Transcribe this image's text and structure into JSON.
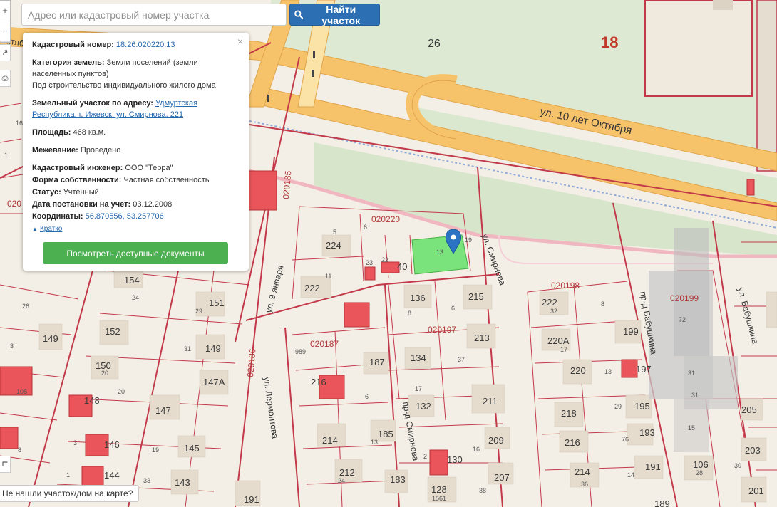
{
  "search": {
    "placeholder": "Адрес или кадастровый номер участка",
    "button_label": "Найти участок",
    "icon": "search-icon"
  },
  "zoom": {
    "plus": "+",
    "minus": "−"
  },
  "popup": {
    "cadastral_label": "Кадастровый номер:",
    "cadastral_value": "18:26:020220:13",
    "category_label": "Категория земель:",
    "category_value": "Земли поселений (земли населенных пунктов)",
    "category_use": "Под строительство индивидуального жилого дома",
    "address_label": "Земельный участок по адресу:",
    "address_value": "Удмуртская Республика, г. Ижевск, ул. Смирнова, 221",
    "area_label": "Площадь:",
    "area_value": "468 кв.м.",
    "survey_label": "Межевание:",
    "survey_value": "Проведено",
    "engineer_label": "Кадастровый инженер:",
    "engineer_value": "ООО \"Терра\"",
    "ownership_label": "Форма собственности:",
    "ownership_value": "Частная собственность",
    "status_label": "Статус:",
    "status_value": "Учтенный",
    "reg_date_label": "Дата постановки на учет:",
    "reg_date_value": "03.12.2008",
    "coords_label": "Координаты:",
    "coords_value": "56.870556, 53.257706",
    "collapse_label": "Кратко",
    "docs_button": "Посмотреть доступные документы",
    "close": "×"
  },
  "not_found_label": "Не нашли участок/дом на карте?",
  "map": {
    "street_labels": {
      "oktyabrya": "ул. 10 лет Октября",
      "smirnova": "ул. Смирнова",
      "smirnova_lane": "пр-д Смирнова",
      "yanvarya": "ул. 9 января",
      "babushkina": "ул. Бабушкина",
      "babushkina_lane": "пр-д Бабушкина",
      "lemontova": "ул. Лермонтова",
      "partial_left": "Октяб"
    },
    "quarters": {
      "q020220": "020220",
      "q020197": "020197",
      "q020198": "020198",
      "q020199": "020199",
      "q020187": "020187",
      "q020185": "020185",
      "q020186": "020186",
      "q020_left": "020"
    },
    "big_numbers": {
      "n18": "18",
      "n26": "26"
    },
    "house_numbers": {
      "h224": "224",
      "h222": "222",
      "h5": "5",
      "h6": "6",
      "h11": "11",
      "h22": "22",
      "h40": "40",
      "h13": "13",
      "h19": "19",
      "h23": "23",
      "h136": "136",
      "h215": "215",
      "h213": "213",
      "h8": "8",
      "h6b": "6",
      "h37": "37",
      "h134": "134",
      "h17": "17",
      "h132": "132",
      "h211": "211",
      "h209": "209",
      "h16": "16",
      "h207": "207",
      "h128": "128",
      "h130": "130",
      "h2": "2",
      "h38": "38",
      "h1561": "1561",
      "h187": "187",
      "h216": "216",
      "h6c": "6",
      "h185": "185",
      "h214": "214",
      "h212": "212",
      "h183": "183",
      "h24": "24",
      "h13b": "13",
      "h989": "989",
      "h222b": "222",
      "h8b": "8",
      "h32": "32",
      "h199": "199",
      "h220A": "220А",
      "h17b": "17",
      "h220": "220",
      "h13c": "13",
      "h197": "197",
      "h218": "218",
      "h29": "29",
      "h195": "195",
      "h216b": "216",
      "h76": "76",
      "h193": "193",
      "h214b": "214",
      "h36": "36",
      "h191": "191",
      "h14": "14",
      "h72": "72",
      "h31": "31",
      "h31b": "31",
      "h15": "15",
      "h106": "106",
      "h28": "28",
      "h205": "205",
      "h203": "203",
      "h201": "201",
      "h30": "30",
      "h154": "154",
      "h24b": "24",
      "h151": "151",
      "h29b": "29",
      "h152": "152",
      "h149": "149",
      "h31c": "31",
      "h150": "150",
      "h20": "20",
      "h147A": "147А",
      "h147": "147",
      "h145": "145",
      "h19b": "19",
      "h143": "143",
      "h33": "33",
      "h148": "148",
      "h146": "146",
      "h144": "144",
      "h3": "3",
      "h1": "1",
      "h26": "26",
      "h149b": "149",
      "h3b": "3",
      "h16b": "16",
      "h1b": "1",
      "h105": "105",
      "h20b": "20",
      "h8c": "8",
      "h191b": "191",
      "h189": "189"
    }
  },
  "colors": {
    "background": "#f4efe6",
    "main_road": "#f6c36b",
    "road_edge": "#e0a44a",
    "green_area": "#d9e8cf",
    "parcel_line": "#c2394a",
    "selected_parcel": "#7be37b",
    "building": "#e5dcce",
    "highlight_building": "#e9555a",
    "marker": "#2b74c4",
    "button_blue": "#2c6fb3",
    "button_green": "#4caf50"
  }
}
